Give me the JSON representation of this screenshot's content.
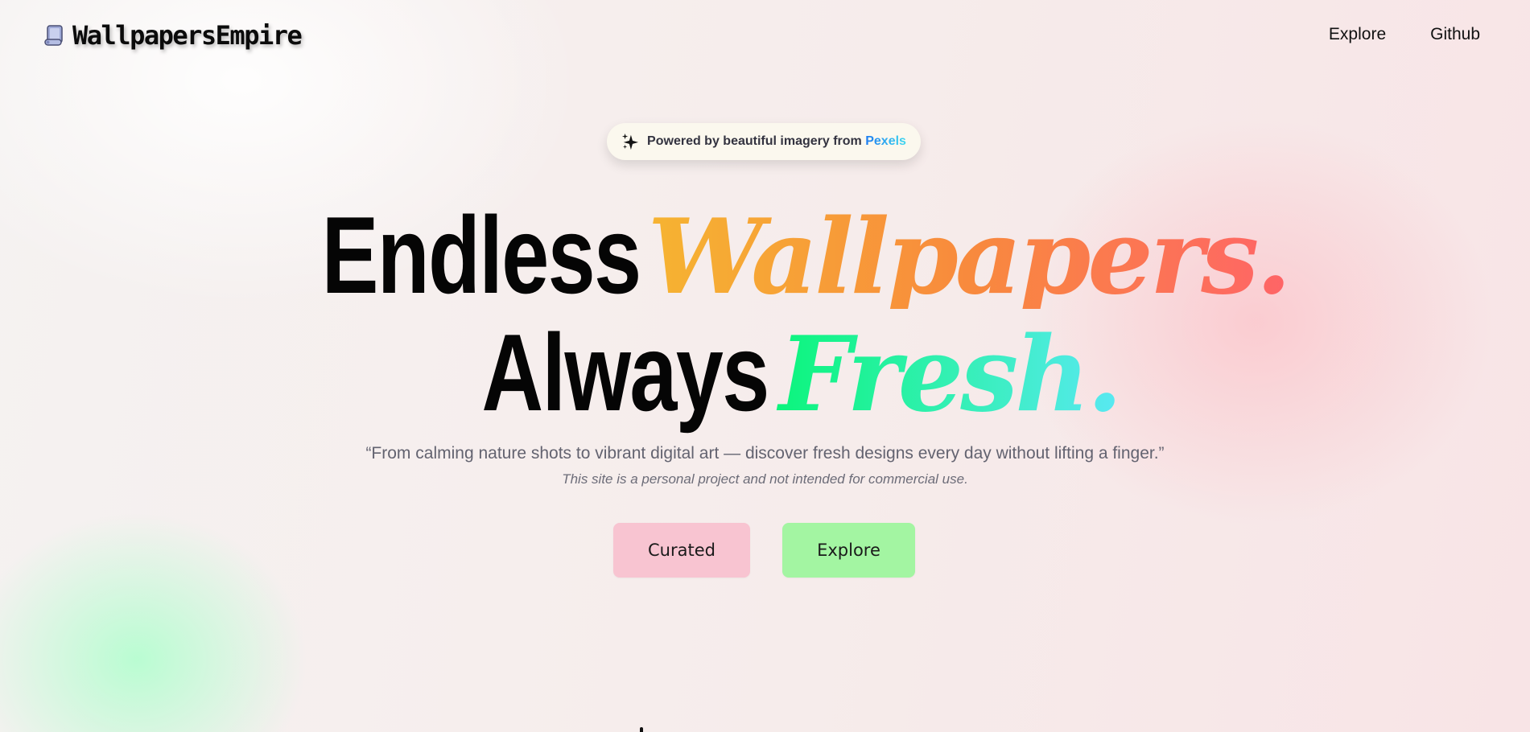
{
  "header": {
    "logo_text": "WallpapersEmpire",
    "logo_icon": "scroll-icon",
    "nav": [
      {
        "label": "Explore"
      },
      {
        "label": "Github"
      }
    ]
  },
  "badge": {
    "icon": "sparkle-icon",
    "text": "Powered by beautiful imagery from",
    "brand": "Pexels"
  },
  "hero": {
    "line1_plain": "Endless",
    "line1_fancy": "Wallpapers.",
    "line2_plain": "Always",
    "line2_fancy": "Fresh.",
    "quote": "“From calming nature shots to vibrant digital art — discover fresh designs every day without lifting a finger.”",
    "disclaimer": "This site is a personal project and not intended for commercial use."
  },
  "buttons": {
    "curated": "Curated",
    "explore": "Explore"
  },
  "colors": {
    "curated_bg": "#f8c4d1",
    "explore_bg": "#a3f5a2",
    "wallpapers_gradient": [
      "#f6b531",
      "#f88a3d",
      "#ff6368"
    ],
    "fresh_gradient": [
      "#0af57a",
      "#37efb9",
      "#5be8f6"
    ],
    "pexels_gradient": [
      "#1e7cf0",
      "#3fd8ef"
    ]
  }
}
